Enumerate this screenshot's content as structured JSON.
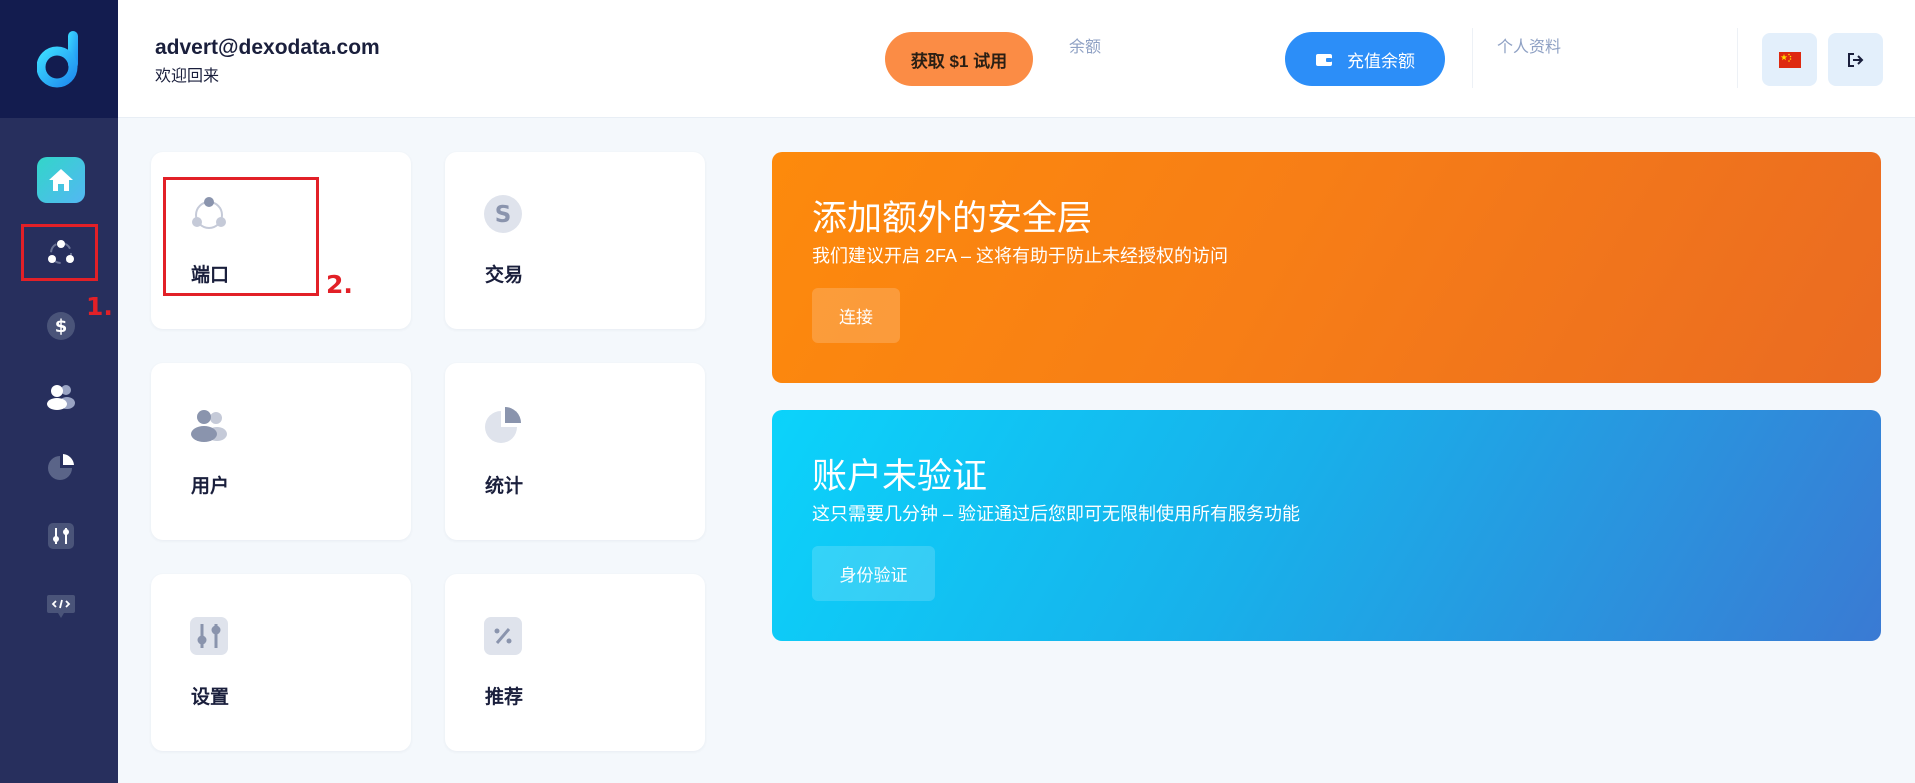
{
  "header": {
    "email": "advert@dexodata.com",
    "welcome": "欢迎回来",
    "trial_button": "获取 $1 试用",
    "balance_label": "余额",
    "topup_button": "充值余额",
    "profile_label": "个人资料"
  },
  "sidebar": {
    "items": [
      {
        "icon": "home-icon"
      },
      {
        "icon": "ports-icon"
      },
      {
        "icon": "dollar-icon"
      },
      {
        "icon": "users-icon"
      },
      {
        "icon": "pie-chart-icon"
      },
      {
        "icon": "sliders-icon"
      },
      {
        "icon": "code-icon"
      }
    ],
    "accent_color": "#32d6c9"
  },
  "tiles": [
    {
      "label": "端口",
      "icon": "ports-icon"
    },
    {
      "label": "交易",
      "icon": "transactions-icon"
    },
    {
      "label": "用户",
      "icon": "users-icon"
    },
    {
      "label": "统计",
      "icon": "pie-chart-icon"
    },
    {
      "label": "设置",
      "icon": "sliders-icon"
    },
    {
      "label": "推荐",
      "icon": "percent-icon"
    }
  ],
  "banners": {
    "security": {
      "title": "添加额外的安全层",
      "subtitle": "我们建议开启 2FA – 这将有助于防止未经授权的访问",
      "button": "连接",
      "color": "#fd8a0c"
    },
    "verify": {
      "title": "账户未验证",
      "subtitle": "这只需要几分钟 – 验证通过后您即可无限制使用所有服务功能",
      "button": "身份验证",
      "color": "#18b0ea"
    }
  },
  "annotations": {
    "step1": "1.",
    "step2": "2.",
    "color": "#e22027"
  }
}
